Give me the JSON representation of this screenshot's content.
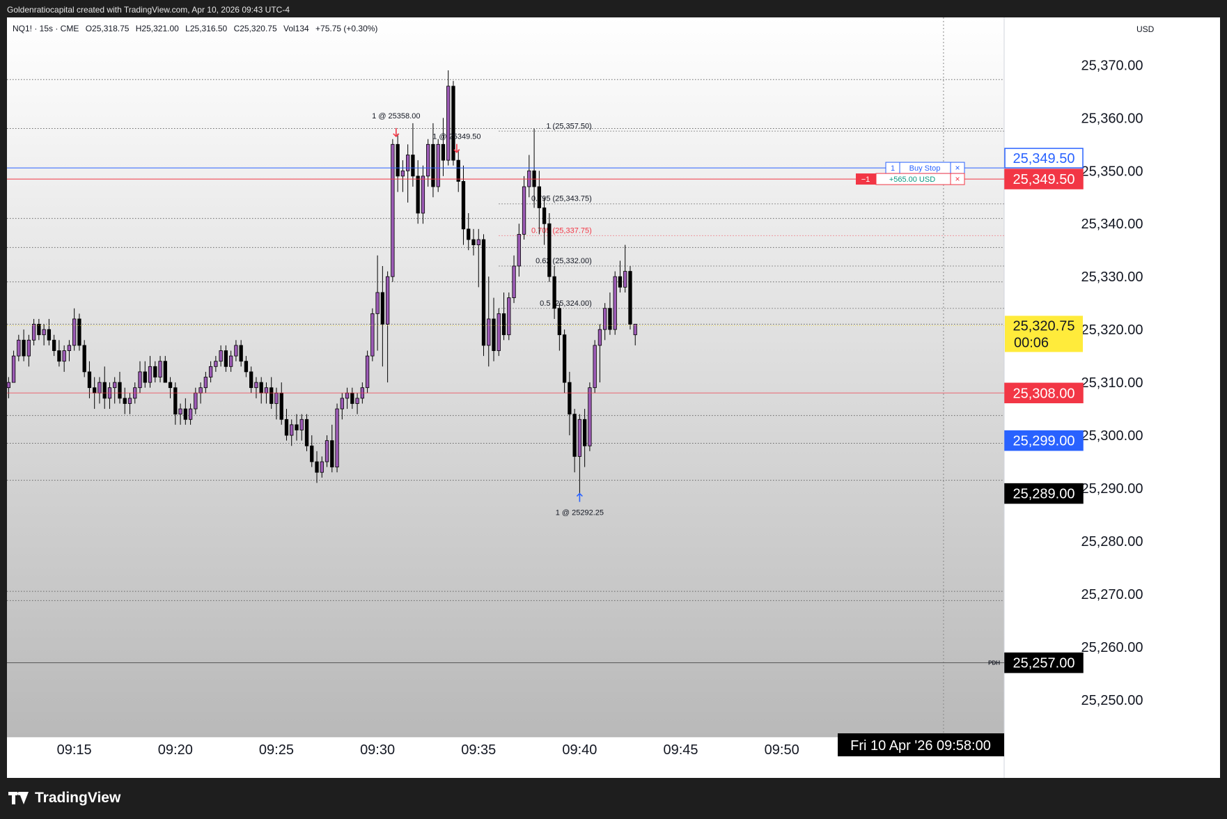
{
  "caption": "Goldenratiocapital created with TradingView.com, Apr 10, 2026 09:43 UTC-4",
  "footer": {
    "brand": "TradingView"
  },
  "header": {
    "symbol": "NQ1! · 15s · CME",
    "open": "O25,318.75",
    "high": "H25,321.00",
    "low": "L25,316.50",
    "close": "C25,320.75",
    "volume": "Vol134",
    "change": "+75.75 (+0.30%)"
  },
  "currency": "USD",
  "colors": {
    "up_body": "#9c5bb5",
    "down_body": "#000000",
    "blue": "#2962ff",
    "red": "#f23645",
    "yellow": "#ffeb3b",
    "green": "#089981"
  },
  "chart_data": {
    "type": "candlestick",
    "ylim": [
      25243,
      25379
    ],
    "y_ticks": [
      25250,
      25260,
      25270,
      25280,
      25290,
      25300,
      25310,
      25320,
      25330,
      25340,
      25350,
      25360,
      25370
    ],
    "y_tick_labels": [
      "25,250.00",
      "25,260.00",
      "25,270.00",
      "25,280.00",
      "25,290.00",
      "25,300.00",
      "25,310.00",
      "25,320.00",
      "25,330.00",
      "25,340.00",
      "25,350.00",
      "25,360.00",
      "25,370.00"
    ],
    "x_ticks": [
      "09:15",
      "09:20",
      "09:25",
      "09:30",
      "09:35",
      "09:40",
      "09:45",
      "09:50"
    ],
    "x_minutes": [
      915,
      920,
      925,
      930,
      935,
      940,
      945,
      950
    ],
    "xlim_minutes": [
      911.67,
      961
    ],
    "bar_seconds": 15,
    "first_bar_minute": 911.75,
    "crosshair": {
      "minute": 958,
      "time_label": "Fri 10 Apr '26   09:58:00"
    },
    "current": {
      "price": 25320.75,
      "label": "25,320.75",
      "countdown": "00:06"
    },
    "price_lines": [
      {
        "price": 25349.5,
        "label": "25,349.50",
        "style": "blue-box"
      },
      {
        "price": 25349.5,
        "label": "25,349.50",
        "style": "red"
      },
      {
        "price": 25308.0,
        "label": "25,308.00",
        "style": "red"
      },
      {
        "price": 25299.0,
        "label": "25,299.00",
        "style": "blue"
      },
      {
        "price": 25289.0,
        "label": "25,289.00",
        "style": "black"
      },
      {
        "price": 25257.0,
        "label": "25,257.00",
        "style": "black",
        "tag": "PDH"
      }
    ],
    "horizontal_levels": [
      25367.25,
      25358.0,
      25341.0,
      25335.5,
      25329.0,
      25321.0,
      25303.75,
      25298.5,
      25291.5,
      25270.5,
      25268.75
    ],
    "fib_levels": [
      {
        "price": 25357.5,
        "label": "1 (25,357.50)"
      },
      {
        "price": 25343.75,
        "label": "0.795 (25,343.75)"
      },
      {
        "price": 25337.75,
        "label": "0.705 (25,337.75)"
      },
      {
        "price": 25332.0,
        "label": "0.62 (25,332.00)"
      },
      {
        "price": 25324.0,
        "label": "0.5 (25,324.00)"
      }
    ],
    "orders": [
      {
        "qty": "1",
        "type": "Buy Stop",
        "close": "×"
      },
      {
        "qty": "−1",
        "pnl": "+565.00 USD",
        "close": "×"
      }
    ],
    "executions": [
      {
        "label": "1 @ 25358.00",
        "minute": 930.92,
        "price": 25356.5,
        "side": "sell"
      },
      {
        "label": "1 @ 25349.50",
        "minute": 933.92,
        "price": 25353.5,
        "side": "sell"
      },
      {
        "label": "1 @ 25292.25",
        "minute": 940.0,
        "price": 25289.0,
        "side": "buy"
      }
    ],
    "candles": [
      [
        25309,
        25311,
        25307,
        25310
      ],
      [
        25310,
        25316,
        25310,
        25315
      ],
      [
        25315,
        25319,
        25314,
        25318
      ],
      [
        25318,
        25320,
        25314,
        25315
      ],
      [
        25315,
        25319,
        25313,
        25318
      ],
      [
        25318,
        25322,
        25317,
        25321
      ],
      [
        25321,
        25322,
        25318,
        25319
      ],
      [
        25319,
        25321,
        25317,
        25320
      ],
      [
        25320,
        25322,
        25317,
        25318
      ],
      [
        25318,
        25319,
        25315,
        25316
      ],
      [
        25316,
        25318,
        25313,
        25314
      ],
      [
        25314,
        25317,
        25312,
        25316
      ],
      [
        25316,
        25318,
        25314,
        25317
      ],
      [
        25317,
        25324,
        25316,
        25322
      ],
      [
        25322,
        25323,
        25316,
        25317
      ],
      [
        25317,
        25318,
        25311,
        25312
      ],
      [
        25312,
        25314,
        25307,
        25309
      ],
      [
        25309,
        25311,
        25305,
        25308
      ],
      [
        25308,
        25311,
        25306,
        25310
      ],
      [
        25310,
        25313,
        25305,
        25307
      ],
      [
        25307,
        25310,
        25305,
        25309
      ],
      [
        25309,
        25311,
        25306,
        25310
      ],
      [
        25310,
        25312,
        25306,
        25307
      ],
      [
        25307,
        25309,
        25304,
        25306
      ],
      [
        25306,
        25308,
        25304,
        25307
      ],
      [
        25307,
        25310,
        25306,
        25309
      ],
      [
        25309,
        25314,
        25308,
        25312
      ],
      [
        25312,
        25314,
        25309,
        25310
      ],
      [
        25310,
        25315,
        25309,
        25313
      ],
      [
        25313,
        25314,
        25310,
        25311
      ],
      [
        25311,
        25315,
        25310,
        25314
      ],
      [
        25314,
        25315,
        25310,
        25310
      ],
      [
        25310,
        25311,
        25307,
        25309
      ],
      [
        25309,
        25310,
        25302,
        25304
      ],
      [
        25304,
        25306,
        25302,
        25305
      ],
      [
        25305,
        25307,
        25302,
        25303
      ],
      [
        25303,
        25306,
        25302,
        25305
      ],
      [
        25305,
        25309,
        25304,
        25308
      ],
      [
        25308,
        25310,
        25306,
        25309
      ],
      [
        25309,
        25312,
        25308,
        25311
      ],
      [
        25311,
        25314,
        25310,
        25313
      ],
      [
        25313,
        25315,
        25312,
        25314
      ],
      [
        25314,
        25317,
        25313,
        25316
      ],
      [
        25316,
        25317,
        25312,
        25313
      ],
      [
        25313,
        25316,
        25312,
        25315
      ],
      [
        25315,
        25318,
        25314,
        25317
      ],
      [
        25317,
        25318,
        25313,
        25314
      ],
      [
        25314,
        25315,
        25311,
        25312
      ],
      [
        25312,
        25313,
        25308,
        25309
      ],
      [
        25309,
        25311,
        25307,
        25310
      ],
      [
        25310,
        25311,
        25306,
        25308
      ],
      [
        25308,
        25310,
        25306,
        25309
      ],
      [
        25309,
        25311,
        25305,
        25306
      ],
      [
        25306,
        25309,
        25303,
        25308
      ],
      [
        25308,
        25310,
        25302,
        25303
      ],
      [
        25303,
        25305,
        25299,
        25300
      ],
      [
        25300,
        25303,
        25298,
        25302
      ],
      [
        25302,
        25304,
        25299,
        25301
      ],
      [
        25301,
        25304,
        25299,
        25303
      ],
      [
        25303,
        25304,
        25297,
        25298
      ],
      [
        25298,
        25300,
        25294,
        25295
      ],
      [
        25295,
        25297,
        25291,
        25293
      ],
      [
        25293,
        25296,
        25292,
        25295
      ],
      [
        25295,
        25300,
        25294,
        25299
      ],
      [
        25299,
        25302,
        25293,
        25294
      ],
      [
        25294,
        25306,
        25293,
        25305
      ],
      [
        25305,
        25308,
        25303,
        25307
      ],
      [
        25307,
        25309,
        25305,
        25308
      ],
      [
        25308,
        25309,
        25305,
        25306
      ],
      [
        25306,
        25308,
        25304,
        25307
      ],
      [
        25307,
        25310,
        25306,
        25309
      ],
      [
        25309,
        25316,
        25308,
        25315
      ],
      [
        25315,
        25324,
        25314,
        25323
      ],
      [
        25323,
        25334,
        25316,
        25327
      ],
      [
        25327,
        25332,
        25313,
        25321
      ],
      [
        25321,
        25331,
        25310,
        25330
      ],
      [
        25330,
        25356,
        25329,
        25355
      ],
      [
        25355,
        25357,
        25346,
        25349
      ],
      [
        25349,
        25352,
        25346,
        25350
      ],
      [
        25350,
        25355,
        25344,
        25353
      ],
      [
        25353,
        25359,
        25347,
        25349
      ],
      [
        25349,
        25352,
        25340,
        25342
      ],
      [
        25342,
        25351,
        25340,
        25349
      ],
      [
        25349,
        25356,
        25347,
        25355
      ],
      [
        25355,
        25359,
        25345,
        25347
      ],
      [
        25347,
        25356,
        25346,
        25355
      ],
      [
        25355,
        25360,
        25349,
        25352
      ],
      [
        25352,
        25369,
        25351,
        25366
      ],
      [
        25366,
        25367,
        25351,
        25352
      ],
      [
        25352,
        25354,
        25346,
        25348
      ],
      [
        25348,
        25351,
        25336,
        25339
      ],
      [
        25339,
        25342,
        25335,
        25337
      ],
      [
        25337,
        25339,
        25334,
        25336
      ],
      [
        25336,
        25339,
        25328,
        25337
      ],
      [
        25337,
        25338,
        25315,
        25317
      ],
      [
        25317,
        25330,
        25313,
        25322
      ],
      [
        25322,
        25326,
        25314,
        25316
      ],
      [
        25316,
        25324,
        25315,
        25323
      ],
      [
        25323,
        25327,
        25318,
        25319
      ],
      [
        25319,
        25327,
        25318,
        25326
      ],
      [
        25326,
        25334,
        25325,
        25332
      ],
      [
        25332,
        25340,
        25330,
        25338
      ],
      [
        25338,
        25349,
        25337,
        25347
      ],
      [
        25347,
        25353,
        25345,
        25350
      ],
      [
        25350,
        25358,
        25343,
        25347
      ],
      [
        25347,
        25350,
        25338,
        25343
      ],
      [
        25343,
        25345,
        25336,
        25340
      ],
      [
        25340,
        25342,
        25329,
        25330
      ],
      [
        25330,
        25332,
        25322,
        25324
      ],
      [
        25324,
        25325,
        25316,
        25319
      ],
      [
        25319,
        25320,
        25308,
        25310
      ],
      [
        25310,
        25312,
        25300,
        25304
      ],
      [
        25304,
        25305,
        25293,
        25296
      ],
      [
        25296,
        25304,
        25289,
        25303
      ],
      [
        25303,
        25305,
        25294,
        25298
      ],
      [
        25298,
        25310,
        25297,
        25309
      ],
      [
        25309,
        25318,
        25308,
        25317
      ],
      [
        25317,
        25321,
        25310,
        25320
      ],
      [
        25320,
        25325,
        25318,
        25324
      ],
      [
        25324,
        25327,
        25319,
        25320
      ],
      [
        25320,
        25331,
        25319,
        25330
      ],
      [
        25330,
        25333,
        25327,
        25328
      ],
      [
        25328,
        25336,
        25327,
        25331
      ],
      [
        25331,
        25332,
        25320,
        25321
      ],
      [
        25319,
        25321,
        25317,
        25321
      ]
    ]
  }
}
